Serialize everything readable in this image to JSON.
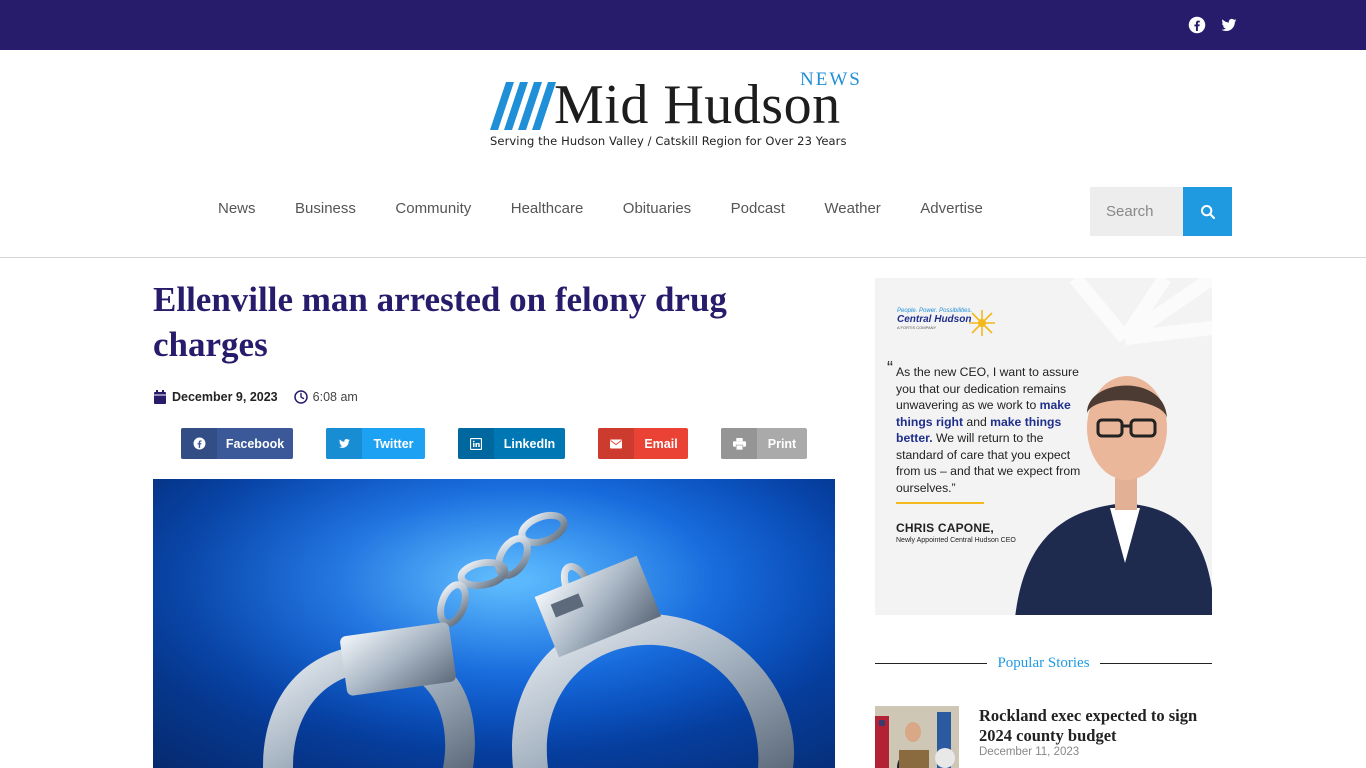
{
  "topbar": {
    "social": [
      {
        "icon": "facebook-icon"
      },
      {
        "icon": "twitter-icon"
      }
    ],
    "background": "#271c6c"
  },
  "logo": {
    "name": "Mid Hudson",
    "news": "NEWS",
    "tagline": "Serving the Hudson Valley / Catskill Region for Over 23 Years"
  },
  "nav": {
    "items": [
      "News",
      "Business",
      "Community",
      "Healthcare",
      "Obituaries",
      "Podcast",
      "Weather",
      "Advertise"
    ]
  },
  "search": {
    "placeholder": "Search",
    "icon": "search-icon",
    "accent": "#1f9ae0"
  },
  "article": {
    "title": "Ellenville man arrested on felony drug charges",
    "date": "December 9, 2023",
    "time": "6:08 am",
    "title_color": "#271c6c"
  },
  "share": [
    {
      "label": "Facebook",
      "icon": "facebook-icon",
      "color": "#3b5998"
    },
    {
      "label": "Twitter",
      "icon": "twitter-icon",
      "color": "#1da1f2"
    },
    {
      "label": "LinkedIn",
      "icon": "linkedin-icon",
      "color": "#0077b5"
    },
    {
      "label": "Email",
      "icon": "email-icon",
      "color": "#ea4335"
    },
    {
      "label": "Print",
      "icon": "print-icon",
      "color": "#aaaaaa"
    }
  ],
  "ad": {
    "brand_tagline": "People. Power. Possibilities.",
    "brand_name": "Central Hudson",
    "brand_sub": "A FORTIS COMPANY",
    "quote_parts": [
      "As the new CEO, I want to assure you that our dedication remains unwavering as we work to ",
      "make things right",
      " and ",
      "make things better.",
      " We will return to the standard of care that you expect from us – and that we expect from ourselves.”"
    ],
    "open_quote": "“",
    "person_name": "CHRIS CAPONE,",
    "person_role": "Newly Appointed Central Hudson CEO"
  },
  "popular": {
    "heading": "Popular Stories",
    "stories": [
      {
        "title": "Rockland exec expected to sign 2024 county budget",
        "date": "December 11, 2023"
      }
    ]
  }
}
